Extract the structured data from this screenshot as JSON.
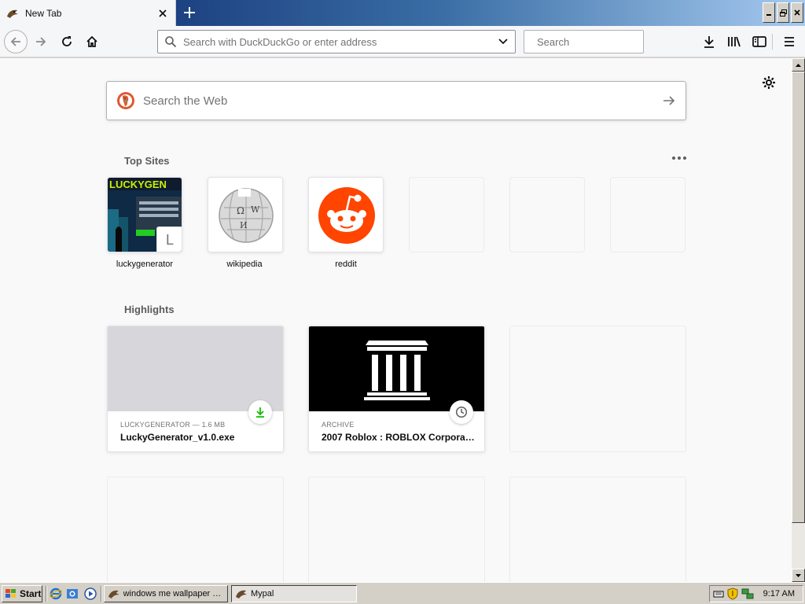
{
  "browser": {
    "tab": {
      "title": "New Tab",
      "close_glyph": "✕"
    },
    "new_tab_glyph": "+",
    "urlbar": {
      "placeholder": "Search with DuckDuckGo or enter address",
      "value": ""
    },
    "searchbar": {
      "placeholder": "Search",
      "value": ""
    },
    "window_controls": [
      "minimize",
      "restore",
      "close"
    ]
  },
  "newtab": {
    "websearch": {
      "placeholder": "Search the Web",
      "engine_icon": "duckduckgo-icon"
    },
    "topsites": {
      "title": "Top Sites",
      "sites": [
        {
          "label": "luckygenerator",
          "fallback_letter": "L",
          "thumb_text": "LUCKYGEN"
        },
        {
          "label": "wikipedia",
          "icon": "wikipedia-globe-icon"
        },
        {
          "label": "reddit",
          "icon": "reddit-alien-icon"
        },
        {
          "label": ""
        },
        {
          "label": ""
        },
        {
          "label": ""
        }
      ]
    },
    "highlights": {
      "title": "Highlights",
      "cards": [
        {
          "meta": "LUCKYGENERATOR — 1.6 MB",
          "title": "LuckyGenerator_v1.0.exe",
          "badge": "download-icon"
        },
        {
          "meta": "ARCHIVE",
          "title": "2007 Roblox : ROBLOX Corporat...",
          "badge": "history-clock-icon"
        }
      ]
    }
  },
  "taskbar": {
    "start_label": "Start",
    "tasks": [
      {
        "label": "windows me wallpaper at..."
      },
      {
        "label": "Mypal"
      }
    ],
    "clock": "9:17 AM"
  },
  "colors": {
    "accent_blue": "#0a246a",
    "reddit_orange": "#ff4500",
    "download_green": "#12bc00",
    "page_bg": "#f9f9fa"
  }
}
